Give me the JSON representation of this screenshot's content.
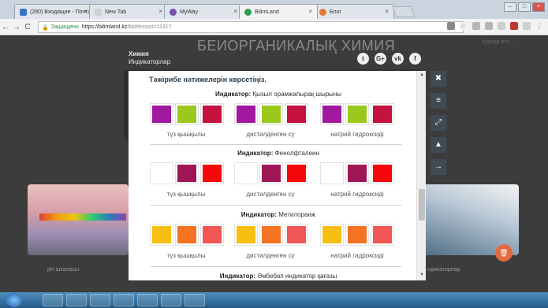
{
  "browser": {
    "tabs": [
      {
        "label": "(280) Входящие - Почта",
        "fav_color": "#3b73c4"
      },
      {
        "label": "New Tab",
        "fav_color": "#d0d0d0"
      },
      {
        "label": "MyWay",
        "fav_color": "#7a4fb0"
      },
      {
        "label": "BilimLand",
        "fav_color": "#2e9e4f"
      },
      {
        "label": "Блог",
        "fav_color": "#e0793a"
      }
    ],
    "url_security": "Защищено",
    "url_host": "https://bilimland.kz",
    "url_path": "/kk#lesson=11317"
  },
  "page": {
    "title": "БЕИОРГАНИКАЛЫҚ ХИМИЯ",
    "subject": "Химия",
    "topic": "Индикаторлар",
    "back_link": "Курсқа өту →",
    "social": [
      "t",
      "G+",
      "vk",
      "f"
    ],
    "bg_left_label": "pH шкаласы",
    "bg_right_label": "ндикаторлар"
  },
  "modal": {
    "title": "Тәжірибе нәтижелерін көрсетіңіз.",
    "indicators": [
      {
        "prefix": "Индикатор:",
        "name": "Қызыл орамжапырақ шырыны",
        "groups": [
          {
            "label": "түз қышқылы",
            "colors": [
              "#a0199f",
              "#9ac91c",
              "#c5123f"
            ]
          },
          {
            "label": "дистилденген су",
            "colors": [
              "#a0199f",
              "#9ac91c",
              "#c5123f"
            ]
          },
          {
            "label": "натрий гидроксиді",
            "colors": [
              "#a0199f",
              "#9ac91c",
              "#c5123f"
            ]
          }
        ]
      },
      {
        "prefix": "Индикатор:",
        "name": "Фенолфталеин",
        "groups": [
          {
            "label": "түз қышқылы",
            "colors": [
              "#ffffff",
              "#9e1656",
              "#f6080a"
            ]
          },
          {
            "label": "дистилденген су",
            "colors": [
              "#ffffff",
              "#9e1656",
              "#f6080a"
            ]
          },
          {
            "label": "натрий гидроксиді",
            "colors": [
              "#ffffff",
              "#9e1656",
              "#f6080a"
            ]
          }
        ]
      },
      {
        "prefix": "Индикатор:",
        "name": "Метилоранж",
        "groups": [
          {
            "label": "түз қышқылы",
            "colors": [
              "#f5c012",
              "#f47221",
              "#f05656"
            ]
          },
          {
            "label": "дистилденген су",
            "colors": [
              "#f5c012",
              "#f47221",
              "#f05656"
            ]
          },
          {
            "label": "натрий гидроксиді",
            "colors": [
              "#f5c012",
              "#f47221",
              "#f05656"
            ]
          }
        ]
      },
      {
        "prefix": "Индикатор:",
        "name": "Әмбебап индикатор қағазы",
        "groups": []
      }
    ]
  },
  "side_buttons": [
    {
      "name": "close-icon",
      "glyph": "✖"
    },
    {
      "name": "menu-icon",
      "glyph": "≡"
    },
    {
      "name": "expand-icon",
      "glyph": "⤢"
    },
    {
      "name": "warning-icon",
      "glyph": "▲"
    },
    {
      "name": "next-icon",
      "glyph": "→"
    }
  ]
}
